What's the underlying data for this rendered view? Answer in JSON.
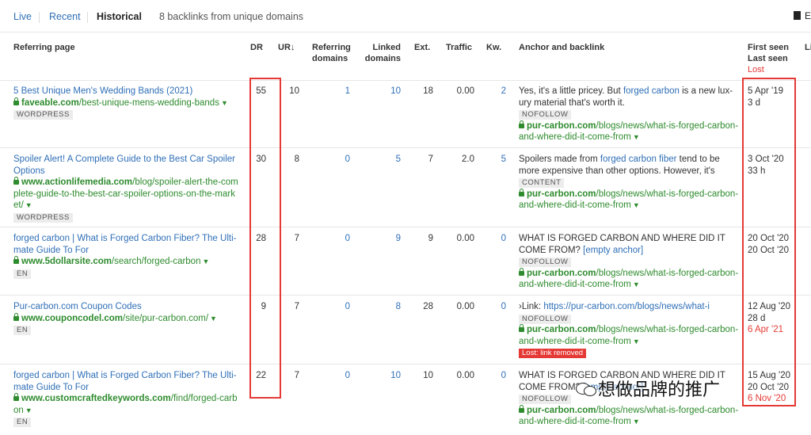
{
  "tabs": [
    {
      "label": "Live"
    },
    {
      "label": "Recent"
    },
    {
      "label": "Historical"
    }
  ],
  "summary": "8 backlinks from unique domains",
  "export_label": "E",
  "columns": {
    "referring_page": "Referring page",
    "dr": "DR",
    "ur": "UR",
    "sort_arrow": "↓",
    "referring_domains_1": "Referring",
    "referring_domains_2": "domains",
    "linked_domains_1": "Linked",
    "linked_domains_2": "domains",
    "ext": "Ext.",
    "traffic": "Traffic",
    "kw": "Kw.",
    "anchor": "Anchor and backlink",
    "first_seen": "First seen",
    "last_seen": "Last seen",
    "lost": "Lost",
    "extra": "Li"
  },
  "rows": [
    {
      "title1": "5 Best Unique Men's Wedding Bands (2021)",
      "title2": "",
      "url_domain": "faveable.com",
      "url_path1": "/best-unique-mens-wedding-bands",
      "url_path2": "",
      "tag": "WORDPRESS",
      "dr": "55",
      "ur": "10",
      "ref_domains": "1",
      "linked_domains": "10",
      "ext": "18",
      "traffic": "0.00",
      "kw": "2",
      "anchor_pre": "Yes, it's a little pricey. But ",
      "anchor_link": "forged carbon",
      "anchor_post": " is a new lux-",
      "anchor_line2": "ury material that's worth it.",
      "anchor_tag": "NOFOLLOW",
      "back_domain": "pur-carbon.com",
      "back_path1": "/blogs/news/what-is-forged-carbon-",
      "back_path2": "and-where-did-it-come-from",
      "lost_badge": "",
      "first_seen": "5 Apr '19",
      "last_seen": "3 d",
      "lost_date": ""
    },
    {
      "title1": "Spoiler Alert! A Complete Guide to the Best Car Spoiler",
      "title2": "Options",
      "url_domain": "www.actionlifemedia.com",
      "url_path1": "/blog/spoiler-alert-the-com",
      "url_path2": "plete-guide-to-the-best-car-spoiler-options-on-the-mark",
      "url_path3": "et/",
      "tag": "WORDPRESS",
      "dr": "30",
      "ur": "8",
      "ref_domains": "0",
      "linked_domains": "5",
      "ext": "7",
      "traffic": "2.0",
      "kw": "5",
      "anchor_pre": "Spoilers made from ",
      "anchor_link": "forged carbon fiber",
      "anchor_post": " tend to be",
      "anchor_line2": "more expensive than other options. However, it's",
      "anchor_tag": "CONTENT",
      "back_domain": "pur-carbon.com",
      "back_path1": "/blogs/news/what-is-forged-carbon-",
      "back_path2": "and-where-did-it-come-from",
      "lost_badge": "",
      "first_seen": "3 Oct '20",
      "last_seen": "33 h",
      "lost_date": ""
    },
    {
      "title1": "forged carbon | What is Forged Carbon Fiber? The Ulti-",
      "title2": "mate Guide To For",
      "url_domain": "www.5dollarsite.com",
      "url_path1": "/search/forged-carbon",
      "url_path2": "",
      "tag": "EN",
      "dr": "28",
      "ur": "7",
      "ref_domains": "0",
      "linked_domains": "9",
      "ext": "9",
      "traffic": "0.00",
      "kw": "0",
      "anchor_pre": "WHAT IS FORGED CARBON AND WHERE DID IT",
      "anchor_link": "",
      "anchor_post": "",
      "anchor_line2_pre": "COME FROM? ",
      "anchor_line2_link": "[empty anchor]",
      "anchor_tag": "NOFOLLOW",
      "back_domain": "pur-carbon.com",
      "back_path1": "/blogs/news/what-is-forged-carbon-",
      "back_path2": "and-where-did-it-come-from",
      "lost_badge": "",
      "first_seen": "20 Oct '20",
      "last_seen": "20 Oct '20",
      "lost_date": ""
    },
    {
      "title1": "Pur-carbon.com Coupon Codes",
      "title2": "",
      "url_domain": "www.couponcodel.com",
      "url_path1": "/site/pur-carbon.com/",
      "url_path2": "",
      "tag": "EN",
      "dr": "9",
      "ur": "7",
      "ref_domains": "0",
      "linked_domains": "8",
      "ext": "28",
      "traffic": "0.00",
      "kw": "0",
      "anchor_pre": "›Link: ",
      "anchor_link": "https://pur-carbon.com/blogs/news/what-i",
      "anchor_post": "",
      "anchor_tag": "NOFOLLOW",
      "back_domain": "pur-carbon.com",
      "back_path1": "/blogs/news/what-is-forged-carbon-",
      "back_path2": "and-where-did-it-come-from",
      "lost_badge": "Lost: link removed",
      "first_seen": "12 Aug '20",
      "last_seen": "28 d",
      "lost_date": "6 Apr '21"
    },
    {
      "title1": "forged carbon | What is Forged Carbon Fiber? The Ulti-",
      "title2": "mate Guide To For",
      "url_domain": "www.customcraftedkeywords.com",
      "url_path1": "/find/forged-carb",
      "url_path2": "on",
      "tag": "EN",
      "dr": "22",
      "ur": "7",
      "ref_domains": "0",
      "linked_domains": "10",
      "ext": "10",
      "traffic": "0.00",
      "kw": "0",
      "anchor_pre": "WHAT IS FORGED CARBON AND WHERE DID IT",
      "anchor_link": "",
      "anchor_post": "",
      "anchor_line2_pre": "COME FROM? ",
      "anchor_line2_link": "[empty anchor]",
      "anchor_tag": "NOFOLLOW",
      "back_domain": "pur-carbon.com",
      "back_path1": "/blogs/news/what-is-forged-carbon-",
      "back_path2": "and-where-did-it-come-from",
      "lost_badge": "",
      "first_seen": "15 Aug '20",
      "last_seen": "20 Oct '20",
      "lost_date": "6 Nov '20"
    }
  ],
  "watermark": "想做品牌的推广",
  "colors": {
    "link": "#2f6fb7",
    "green": "#2e8b2e",
    "red": "#e53935"
  }
}
